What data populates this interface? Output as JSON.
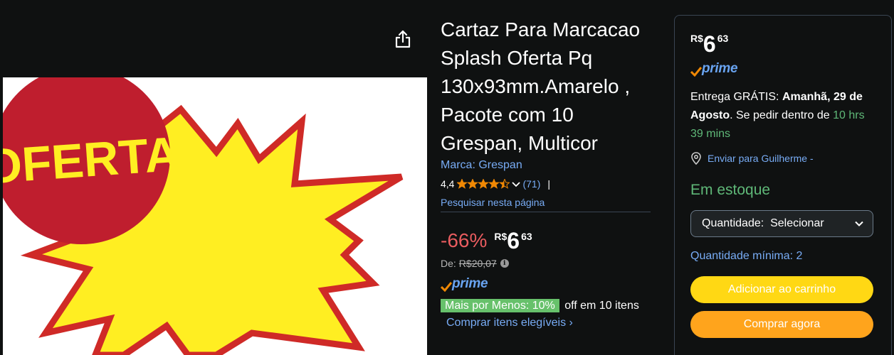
{
  "product": {
    "title": "Cartaz Para Marcacao Splash Oferta Pq 130x93mm.Amarelo , Pacote com 10 Grespan, Multicor",
    "brand": "Marca: Grespan",
    "rating": "4,4",
    "rating_count": "(71)",
    "rating_pipe": "|",
    "search_page": "Pesquisar nesta página",
    "image_text": "OFERTA"
  },
  "pricing": {
    "discount": "-66%",
    "currency": "R$",
    "whole": "6",
    "fraction": "63",
    "was_label": "De:",
    "was_price": "R$20,07",
    "prime_label": "prime",
    "mpm_badge": "Mais por Menos: 10%",
    "mpm_text": "off em 10 itens",
    "mpm_link": "Comprar itens elegíveis ›"
  },
  "buybox": {
    "currency": "R$",
    "whole": "6",
    "fraction": "63",
    "prime_label": "prime",
    "delivery_prefix": "Entrega GRÁTIS: ",
    "delivery_date": "Amanhã, 29 de Agosto",
    "delivery_mid": ". Se pedir dentro de ",
    "delivery_time": "10 hrs 39 mins",
    "ship_to": "Enviar para Guilherme -",
    "stock": "Em estoque",
    "qty_label": "Quantidade:",
    "qty_value": "Selecionar",
    "min_qty": "Quantidade mínima: 2",
    "add_to_cart": "Adicionar ao carrinho",
    "buy_now": "Comprar agora"
  },
  "colors": {
    "background": "#0f1111",
    "link": "#78acf5",
    "discount": "#e85c5f",
    "stock": "#5fb878",
    "cart_button": "#ffd814",
    "buy_button": "#ffa41c",
    "star": "#f08804"
  },
  "icons": {
    "share": "share-icon",
    "info": "info-icon",
    "location": "location-pin-icon",
    "dropdown": "chevron-down-icon"
  }
}
